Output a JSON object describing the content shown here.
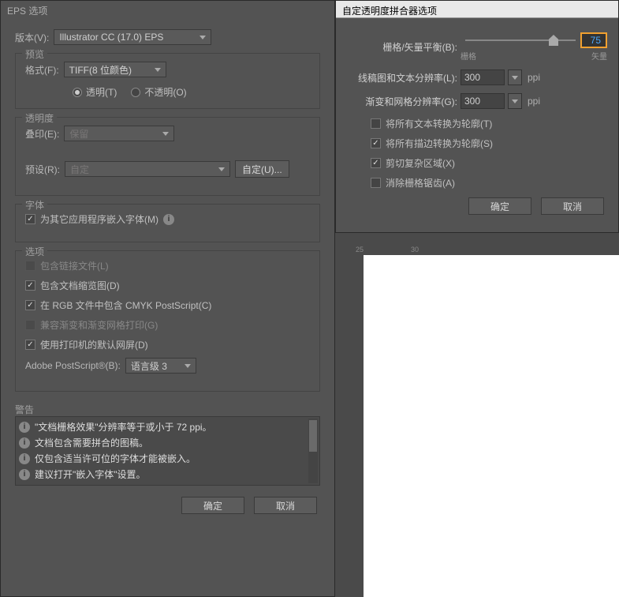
{
  "left": {
    "title": "EPS 选项",
    "version_label": "版本(V):",
    "version_value": "Illustrator CC (17.0) EPS",
    "preview": {
      "legend": "预览",
      "format_label": "格式(F):",
      "format_value": "TIFF(8 位颜色)",
      "radio_transparent": "透明(T)",
      "radio_opaque": "不透明(O)"
    },
    "transparency": {
      "legend": "透明度",
      "overprint_label": "叠印(E):",
      "overprint_value": "保留",
      "preset_label": "预设(R):",
      "preset_value": "自定",
      "custom_btn": "自定(U)..."
    },
    "fonts": {
      "legend": "字体",
      "embed": "为其它应用程序嵌入字体(M)"
    },
    "options": {
      "legend": "选项",
      "include_linked": "包含链接文件(L)",
      "include_thumb": "包含文档缩览图(D)",
      "include_cmyk": "在 RGB 文件中包含 CMYK PostScript(C)",
      "compat_gradient": "兼容渐变和渐变网格打印(G)",
      "use_printer": "使用打印机的默认网屏(D)",
      "ps_label": "Adobe PostScript®(B):",
      "ps_value": "语言级 3"
    },
    "warnings": {
      "legend": "警告",
      "w1": "\"文档栅格效果\"分辨率等于或小于 72 ppi。",
      "w2": "文档包含需要拼合的图稿。",
      "w3": "仅包含适当许可位的字体才能被嵌入。",
      "w4": "建议打开\"嵌入字体\"设置。"
    },
    "ok": "确定",
    "cancel": "取消"
  },
  "right": {
    "title": "自定透明度拼合器选项",
    "balance_label": "栅格/矢量平衡(B):",
    "balance_min": "栅格",
    "balance_max": "矢量",
    "balance_value": "75",
    "line_res_label": "线稿图和文本分辨率(L):",
    "line_res_value": "300",
    "grad_res_label": "渐变和网格分辨率(G):",
    "grad_res_value": "300",
    "ppi": "ppi",
    "convert_text": "将所有文本转换为轮廓(T)",
    "convert_stroke": "将所有描边转换为轮廓(S)",
    "clip_complex": "剪切复杂区域(X)",
    "antialias": "消除栅格锯齿(A)",
    "ok": "确定",
    "cancel": "取消"
  },
  "ruler": {
    "m25": "25",
    "m30": "30"
  }
}
